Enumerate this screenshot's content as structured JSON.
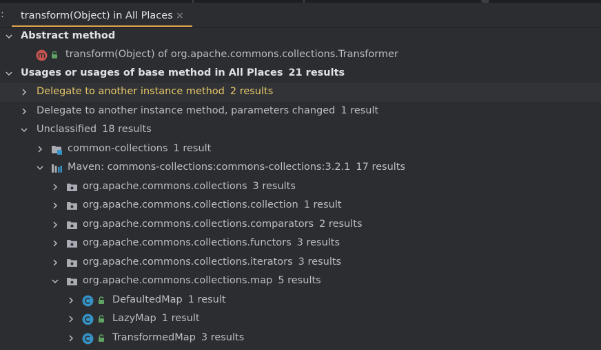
{
  "tab": {
    "title": "transform(Object) in All Places",
    "close_glyph": "×",
    "left_marker": ":"
  },
  "tree": {
    "abstract_header": "Abstract method",
    "abstract_item": "transform(Object) of org.apache.commons.collections.Transformer",
    "usages_header": "Usages or usages of base method in All Places",
    "usages_count": "21 results",
    "delegate": {
      "label": "Delegate to another instance method",
      "count": "2 results"
    },
    "delegate_changed": {
      "label": "Delegate to another instance method, parameters changed",
      "count": "1 result"
    },
    "unclassified": {
      "label": "Unclassified",
      "count": "18 results"
    },
    "common_collections": {
      "label": "common-collections",
      "count": "1 result"
    },
    "maven": {
      "label": "Maven: commons-collections:commons-collections:3.2.1",
      "count": "17 results"
    },
    "packages": [
      {
        "label": "org.apache.commons.collections",
        "count": "3 results"
      },
      {
        "label": "org.apache.commons.collections.collection",
        "count": "1 result"
      },
      {
        "label": "org.apache.commons.collections.comparators",
        "count": "2 results"
      },
      {
        "label": "org.apache.commons.collections.functors",
        "count": "3 results"
      },
      {
        "label": "org.apache.commons.collections.iterators",
        "count": "3 results"
      },
      {
        "label": "org.apache.commons.collections.map",
        "count": "5 results"
      }
    ],
    "classes": [
      {
        "label": "DefaultedMap",
        "count": "1 result"
      },
      {
        "label": "LazyMap",
        "count": "1 result"
      },
      {
        "label": "TransformedMap",
        "count": "3 results"
      }
    ]
  },
  "colors": {
    "background": "#2b2d30",
    "selected_row": "#313336",
    "highlight_text": "#e8c76a",
    "tab_underline": "#e0a44e",
    "class_icon": "#3592c4",
    "method_icon": "#c75450",
    "lock_icon": "#5fa463",
    "folder_icon": "#a9adb3"
  },
  "icons": {
    "expanded": "chevron-down-icon",
    "collapsed": "chevron-right-icon",
    "method": "method-icon",
    "class": "class-icon",
    "package": "package-folder-icon",
    "module": "module-folder-icon",
    "library": "library-icon",
    "access": "lock-icon"
  }
}
